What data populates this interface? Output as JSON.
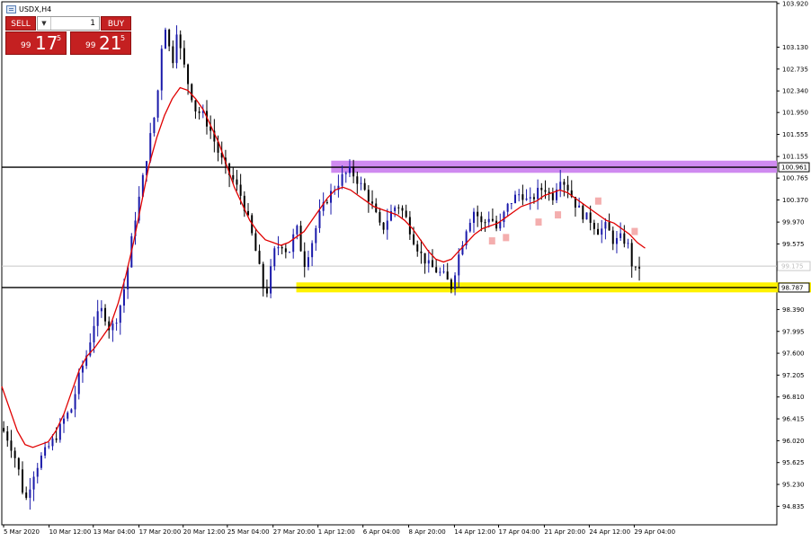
{
  "window": {
    "symbol": "USDX,H4"
  },
  "trade_panel": {
    "sell_label": "SELL",
    "buy_label": "BUY",
    "lot_value": "1",
    "sell_price_prefix": "99",
    "sell_price_big": "17",
    "sell_price_sup": "5",
    "buy_price_prefix": "99",
    "buy_price_big": "21",
    "buy_price_sup": "5"
  },
  "colors": {
    "sell_button": "#c42021",
    "ma_line": "#e00000",
    "bull_candle": "#1a1aaa",
    "bear_candle": "#000000",
    "resistance_zone": "#cf8af0",
    "support_zone": "#fff200",
    "fractal_marker": "#f2a0a0"
  },
  "chart_data": {
    "type": "candlestick",
    "symbol": "USDX",
    "timeframe": "H4",
    "ylim": [
      94.5,
      103.95
    ],
    "y_ticks": [
      "103.920",
      "103.130",
      "102.735",
      "102.340",
      "101.950",
      "101.555",
      "101.155",
      "100.765",
      "100.370",
      "99.970",
      "99.575",
      "99.180",
      "98.785",
      "98.390",
      "97.995",
      "97.600",
      "97.205",
      "96.810",
      "96.415",
      "96.020",
      "95.625",
      "95.230",
      "94.835"
    ],
    "y_tick_values": [
      103.92,
      103.13,
      102.735,
      102.34,
      101.95,
      101.555,
      101.155,
      100.765,
      100.37,
      99.97,
      99.575,
      99.18,
      98.785,
      98.39,
      97.995,
      97.6,
      97.205,
      96.81,
      96.415,
      96.02,
      95.625,
      95.23,
      94.835
    ],
    "x_ticks": [
      "5 Mar 2020",
      "10 Mar 12:00",
      "13 Mar 04:00",
      "17 Mar 20:00",
      "20 Mar 12:00",
      "25 Mar 04:00",
      "27 Mar 20:00",
      "1 Apr 12:00",
      "6 Apr 04:00",
      "8 Apr 20:00",
      "14 Apr 12:00",
      "17 Apr 04:00",
      "21 Apr 20:00",
      "24 Apr 12:00",
      "29 Apr 04:00"
    ],
    "x_tick_fractions": [
      0.0,
      0.061,
      0.118,
      0.177,
      0.234,
      0.291,
      0.35,
      0.408,
      0.466,
      0.525,
      0.584,
      0.641,
      0.7,
      0.758,
      0.816
    ],
    "horizontal_lines": [
      {
        "label": "100.961",
        "value": 100.961,
        "color": "#000000"
      },
      {
        "label": "98.787",
        "value": 98.787,
        "color": "#000000"
      }
    ],
    "current_price": {
      "label": "99.175",
      "value": 99.175
    },
    "zones": [
      {
        "name": "resistance",
        "from": 100.86,
        "to": 101.08,
        "start_fraction": 0.425,
        "color": "#cf8af0"
      },
      {
        "name": "support",
        "from": 98.7,
        "to": 98.88,
        "start_fraction": 0.38,
        "color": "#fff200"
      }
    ],
    "series": [
      {
        "kind": "close_path",
        "points": [
          [
            0.0,
            96.25
          ],
          [
            0.01,
            96.0
          ],
          [
            0.02,
            95.6
          ],
          [
            0.03,
            94.9
          ],
          [
            0.04,
            95.4
          ],
          [
            0.05,
            95.7
          ],
          [
            0.06,
            95.9
          ],
          [
            0.07,
            96.1
          ],
          [
            0.08,
            96.4
          ],
          [
            0.09,
            96.6
          ],
          [
            0.1,
            97.2
          ],
          [
            0.11,
            97.6
          ],
          [
            0.12,
            98.2
          ],
          [
            0.13,
            98.4
          ],
          [
            0.14,
            98.0
          ],
          [
            0.15,
            98.3
          ],
          [
            0.16,
            98.9
          ],
          [
            0.165,
            99.4
          ],
          [
            0.17,
            99.9
          ],
          [
            0.18,
            100.6
          ],
          [
            0.19,
            101.4
          ],
          [
            0.2,
            102.1
          ],
          [
            0.205,
            103.0
          ],
          [
            0.21,
            103.6
          ],
          [
            0.215,
            103.2
          ],
          [
            0.22,
            102.8
          ],
          [
            0.225,
            103.5
          ],
          [
            0.23,
            103.1
          ],
          [
            0.24,
            102.5
          ],
          [
            0.25,
            102.0
          ],
          [
            0.26,
            101.9
          ],
          [
            0.27,
            101.6
          ],
          [
            0.28,
            101.2
          ],
          [
            0.29,
            100.9
          ],
          [
            0.3,
            100.7
          ],
          [
            0.31,
            100.4
          ],
          [
            0.32,
            99.9
          ],
          [
            0.33,
            99.3
          ],
          [
            0.34,
            98.6
          ],
          [
            0.345,
            98.9
          ],
          [
            0.35,
            99.4
          ],
          [
            0.36,
            99.6
          ],
          [
            0.37,
            99.4
          ],
          [
            0.38,
            99.9
          ],
          [
            0.39,
            99.2
          ],
          [
            0.4,
            99.6
          ],
          [
            0.41,
            100.1
          ],
          [
            0.42,
            100.4
          ],
          [
            0.43,
            100.6
          ],
          [
            0.44,
            100.8
          ],
          [
            0.45,
            100.9
          ],
          [
            0.46,
            100.7
          ],
          [
            0.47,
            100.5
          ],
          [
            0.48,
            100.2
          ],
          [
            0.49,
            99.8
          ],
          [
            0.5,
            100.1
          ],
          [
            0.51,
            100.3
          ],
          [
            0.52,
            100.1
          ],
          [
            0.53,
            99.7
          ],
          [
            0.54,
            99.4
          ],
          [
            0.55,
            99.2
          ],
          [
            0.56,
            99.1
          ],
          [
            0.57,
            99.0
          ],
          [
            0.58,
            98.8
          ],
          [
            0.59,
            99.4
          ],
          [
            0.6,
            99.9
          ],
          [
            0.61,
            100.2
          ],
          [
            0.62,
            99.9
          ],
          [
            0.63,
            100.1
          ],
          [
            0.64,
            99.8
          ],
          [
            0.65,
            100.2
          ],
          [
            0.66,
            100.4
          ],
          [
            0.67,
            100.5
          ],
          [
            0.68,
            100.3
          ],
          [
            0.69,
            100.5
          ],
          [
            0.7,
            100.6
          ],
          [
            0.71,
            100.4
          ],
          [
            0.72,
            100.8
          ],
          [
            0.73,
            100.6
          ],
          [
            0.74,
            100.3
          ],
          [
            0.75,
            100.1
          ],
          [
            0.76,
            100.0
          ],
          [
            0.77,
            99.8
          ],
          [
            0.78,
            99.9
          ],
          [
            0.79,
            99.6
          ],
          [
            0.8,
            99.7
          ],
          [
            0.81,
            99.5
          ],
          [
            0.815,
            99.0
          ],
          [
            0.82,
            99.15
          ],
          [
            0.825,
            99.175
          ]
        ]
      },
      {
        "kind": "moving_average",
        "points": [
          [
            0.0,
            97.0
          ],
          [
            0.01,
            96.6
          ],
          [
            0.02,
            96.2
          ],
          [
            0.03,
            95.95
          ],
          [
            0.04,
            95.9
          ],
          [
            0.05,
            95.95
          ],
          [
            0.06,
            96.0
          ],
          [
            0.07,
            96.2
          ],
          [
            0.08,
            96.5
          ],
          [
            0.09,
            96.9
          ],
          [
            0.1,
            97.3
          ],
          [
            0.11,
            97.55
          ],
          [
            0.12,
            97.7
          ],
          [
            0.13,
            97.9
          ],
          [
            0.14,
            98.1
          ],
          [
            0.15,
            98.5
          ],
          [
            0.16,
            99.0
          ],
          [
            0.17,
            99.6
          ],
          [
            0.18,
            100.3
          ],
          [
            0.19,
            101.0
          ],
          [
            0.2,
            101.5
          ],
          [
            0.21,
            101.9
          ],
          [
            0.22,
            102.2
          ],
          [
            0.23,
            102.4
          ],
          [
            0.24,
            102.35
          ],
          [
            0.25,
            102.2
          ],
          [
            0.26,
            102.0
          ],
          [
            0.27,
            101.7
          ],
          [
            0.28,
            101.4
          ],
          [
            0.29,
            101.0
          ],
          [
            0.3,
            100.6
          ],
          [
            0.31,
            100.3
          ],
          [
            0.32,
            100.0
          ],
          [
            0.33,
            99.8
          ],
          [
            0.34,
            99.65
          ],
          [
            0.35,
            99.6
          ],
          [
            0.36,
            99.55
          ],
          [
            0.37,
            99.6
          ],
          [
            0.38,
            99.7
          ],
          [
            0.39,
            99.8
          ],
          [
            0.4,
            100.0
          ],
          [
            0.41,
            100.2
          ],
          [
            0.42,
            100.4
          ],
          [
            0.43,
            100.55
          ],
          [
            0.44,
            100.6
          ],
          [
            0.45,
            100.55
          ],
          [
            0.46,
            100.45
          ],
          [
            0.47,
            100.35
          ],
          [
            0.48,
            100.25
          ],
          [
            0.49,
            100.2
          ],
          [
            0.5,
            100.15
          ],
          [
            0.51,
            100.1
          ],
          [
            0.52,
            100.0
          ],
          [
            0.53,
            99.85
          ],
          [
            0.54,
            99.65
          ],
          [
            0.55,
            99.45
          ],
          [
            0.56,
            99.3
          ],
          [
            0.57,
            99.25
          ],
          [
            0.58,
            99.3
          ],
          [
            0.59,
            99.45
          ],
          [
            0.6,
            99.6
          ],
          [
            0.61,
            99.75
          ],
          [
            0.62,
            99.85
          ],
          [
            0.63,
            99.9
          ],
          [
            0.64,
            99.95
          ],
          [
            0.65,
            100.05
          ],
          [
            0.66,
            100.15
          ],
          [
            0.67,
            100.25
          ],
          [
            0.68,
            100.3
          ],
          [
            0.69,
            100.35
          ],
          [
            0.7,
            100.45
          ],
          [
            0.71,
            100.5
          ],
          [
            0.72,
            100.55
          ],
          [
            0.73,
            100.5
          ],
          [
            0.74,
            100.4
          ],
          [
            0.75,
            100.3
          ],
          [
            0.76,
            100.2
          ],
          [
            0.77,
            100.1
          ],
          [
            0.78,
            100.0
          ],
          [
            0.79,
            99.95
          ],
          [
            0.8,
            99.85
          ],
          [
            0.81,
            99.75
          ],
          [
            0.82,
            99.6
          ],
          [
            0.83,
            99.5
          ]
        ]
      }
    ],
    "fractal_markers": [
      [
        0.632,
        99.63
      ],
      [
        0.65,
        99.69
      ],
      [
        0.692,
        99.97
      ],
      [
        0.717,
        100.1
      ],
      [
        0.769,
        100.35
      ],
      [
        0.816,
        99.8
      ]
    ],
    "legend": "none"
  }
}
